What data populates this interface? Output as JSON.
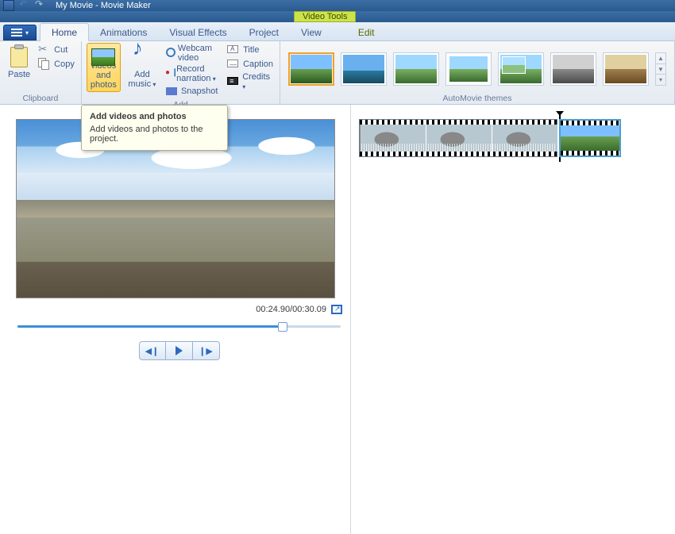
{
  "window": {
    "title": "My Movie - Movie Maker",
    "context_tab": "Video Tools"
  },
  "tabs": {
    "home": "Home",
    "animations": "Animations",
    "visual_effects": "Visual Effects",
    "project": "Project",
    "view": "View",
    "edit": "Edit"
  },
  "ribbon": {
    "clipboard": {
      "label": "Clipboard",
      "paste": "Paste",
      "cut": "Cut",
      "copy": "Copy"
    },
    "add": {
      "label": "Add",
      "add_videos_photos": "Add videos and photos",
      "add_music": "Add music",
      "webcam_video": "Webcam video",
      "record_narration": "Record narration",
      "snapshot": "Snapshot",
      "title": "Title",
      "caption": "Caption",
      "credits": "Credits"
    },
    "automovie": {
      "label": "AutoMovie themes"
    }
  },
  "tooltip": {
    "title": "Add videos and photos",
    "body": "Add videos and photos to the project."
  },
  "preview": {
    "time": "00:24.90/00:30.09"
  }
}
